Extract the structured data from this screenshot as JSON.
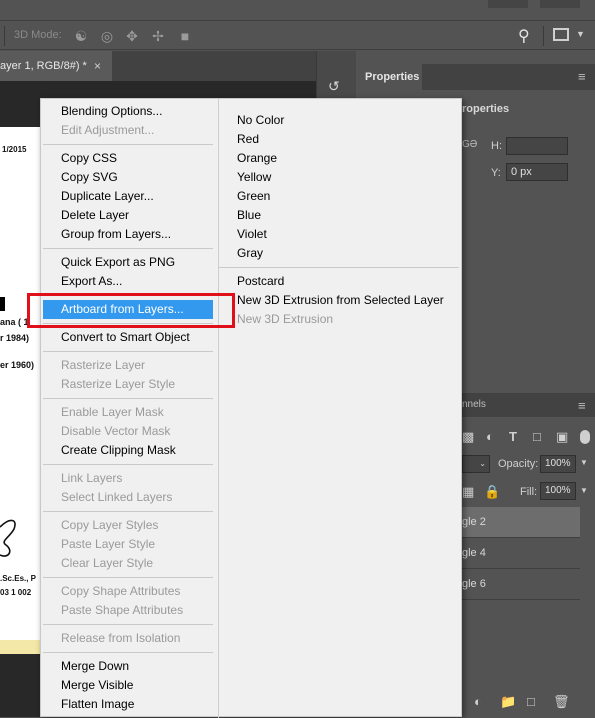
{
  "toolbar": {
    "mode_label": "3D Mode:"
  },
  "document_tab": {
    "title": "ayer 1, RGB/8#) *",
    "close_glyph": "×"
  },
  "document_preview": {
    "date_text": "1/2015",
    "name_text": "ana ( 1",
    "line2_text": "r 1984)",
    "line3_text": "er 1960)",
    "degree_text": ".Sc.Es., P",
    "nip_text": "03 1 002"
  },
  "properties_panel": {
    "tab_label": "Properties",
    "subheading": "roperties",
    "h_label": "H:",
    "y_label": "Y:",
    "y_value": "0 px"
  },
  "layers_panel": {
    "tab_label": "nnels",
    "opacity_label": "Opacity:",
    "opacity_value": "100%",
    "fill_label": "Fill:",
    "fill_value": "100%",
    "rows": [
      {
        "label": "gle 2"
      },
      {
        "label": "gle 4"
      },
      {
        "label": "gle 6"
      }
    ]
  },
  "context_menu": {
    "left_items": [
      {
        "label": "Blending Options...",
        "enabled": true
      },
      {
        "label": "Edit Adjustment...",
        "enabled": false
      },
      {
        "label": "Copy CSS",
        "enabled": true
      },
      {
        "label": "Copy SVG",
        "enabled": true
      },
      {
        "label": "Duplicate Layer...",
        "enabled": true
      },
      {
        "label": "Delete Layer",
        "enabled": true
      },
      {
        "label": "Group from Layers...",
        "enabled": true
      },
      {
        "label": "Quick Export as PNG",
        "enabled": true
      },
      {
        "label": "Export As...",
        "enabled": true
      },
      {
        "label": "Artboard from Layers...",
        "enabled": true,
        "highlighted": true
      },
      {
        "label": "Convert to Smart Object",
        "enabled": true
      },
      {
        "label": "Rasterize Layer",
        "enabled": false
      },
      {
        "label": "Rasterize Layer Style",
        "enabled": false
      },
      {
        "label": "Enable Layer Mask",
        "enabled": false
      },
      {
        "label": "Disable Vector Mask",
        "enabled": false
      },
      {
        "label": "Create Clipping Mask",
        "enabled": true
      },
      {
        "label": "Link Layers",
        "enabled": false
      },
      {
        "label": "Select Linked Layers",
        "enabled": false
      },
      {
        "label": "Copy Layer Styles",
        "enabled": false
      },
      {
        "label": "Paste Layer Style",
        "enabled": false
      },
      {
        "label": "Clear Layer Style",
        "enabled": false
      },
      {
        "label": "Copy Shape Attributes",
        "enabled": false
      },
      {
        "label": "Paste Shape Attributes",
        "enabled": false
      },
      {
        "label": "Release from Isolation",
        "enabled": false
      },
      {
        "label": "Merge Down",
        "enabled": true
      },
      {
        "label": "Merge Visible",
        "enabled": true
      },
      {
        "label": "Flatten Image",
        "enabled": true
      }
    ],
    "right_items": [
      {
        "label": "No Color",
        "enabled": true
      },
      {
        "label": "Red",
        "enabled": true
      },
      {
        "label": "Orange",
        "enabled": true
      },
      {
        "label": "Yellow",
        "enabled": true
      },
      {
        "label": "Green",
        "enabled": true
      },
      {
        "label": "Blue",
        "enabled": true
      },
      {
        "label": "Violet",
        "enabled": true
      },
      {
        "label": "Gray",
        "enabled": true
      },
      {
        "label": "Postcard",
        "enabled": true
      },
      {
        "label": "New 3D Extrusion from Selected Layer",
        "enabled": true
      },
      {
        "label": "New 3D Extrusion",
        "enabled": false
      }
    ]
  },
  "annotation": {
    "highlight_color": "#e0101a",
    "target": "Artboard from Layers..."
  },
  "colors": {
    "menu_highlight": "#3399ee",
    "panel_bg": "#535353",
    "canvas_bg": "#282828"
  }
}
